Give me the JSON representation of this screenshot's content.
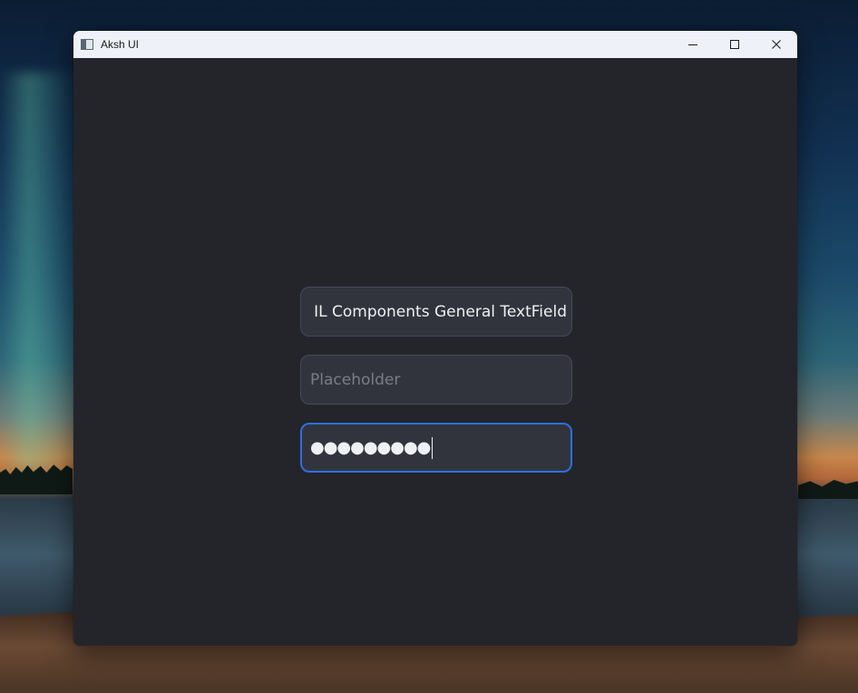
{
  "window": {
    "title": "Aksh UI"
  },
  "fields": {
    "general": {
      "value": "IL Components General TextField"
    },
    "placeholder": {
      "value": "",
      "placeholder": "Placeholder"
    },
    "password": {
      "masked_value": "●●●●●●●●●"
    }
  },
  "icons": {
    "app": "app-window-icon",
    "minimize": "minimize-icon",
    "maximize": "maximize-icon",
    "close": "close-icon"
  },
  "colors": {
    "content_bg": "#23252b",
    "field_bg": "#32343d",
    "field_border": "#474a55",
    "focus_border": "#2f6fe0",
    "titlebar_bg": "#eef2f8"
  }
}
